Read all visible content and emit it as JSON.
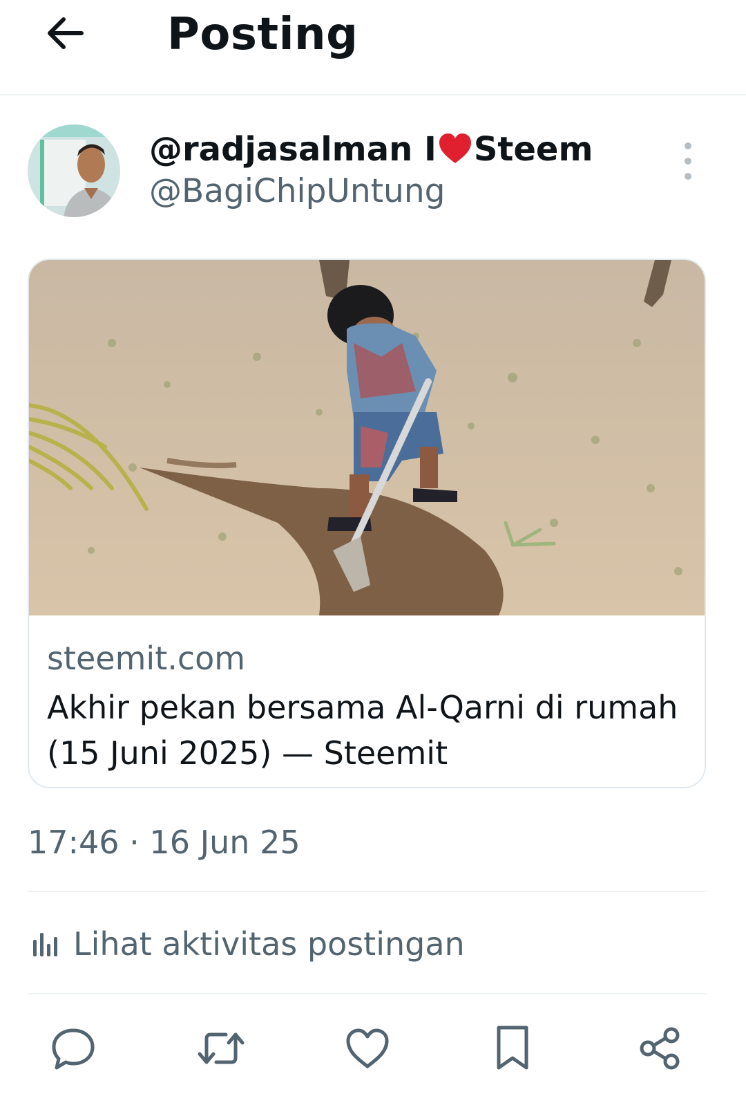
{
  "header": {
    "title": "Posting",
    "back_icon": "arrow-left-icon"
  },
  "author": {
    "name_before_icon": "@radjasalman I",
    "name_icon": "heart-icon",
    "name_icon_color": "#e0202e",
    "name_after_icon": "Steem",
    "handle": "@BagiChipUntung"
  },
  "card": {
    "domain": "steemit.com",
    "title": "Akhir pekan bersama Al-Qarni di rumah (15 Juni 2025) — Steemit"
  },
  "post": {
    "timestamp": "17:46 · 16 Jun 25",
    "activity_label": "Lihat aktivitas postingan",
    "activity_icon": "bar-chart-icon"
  },
  "actions": [
    {
      "icon": "reply-icon"
    },
    {
      "icon": "repost-icon"
    },
    {
      "icon": "like-icon"
    },
    {
      "icon": "bookmark-icon"
    },
    {
      "icon": "share-icon"
    }
  ],
  "colors": {
    "text_primary": "#0f1419",
    "text_secondary": "#536471",
    "divider": "#eff3f4",
    "icon": "#536471"
  }
}
